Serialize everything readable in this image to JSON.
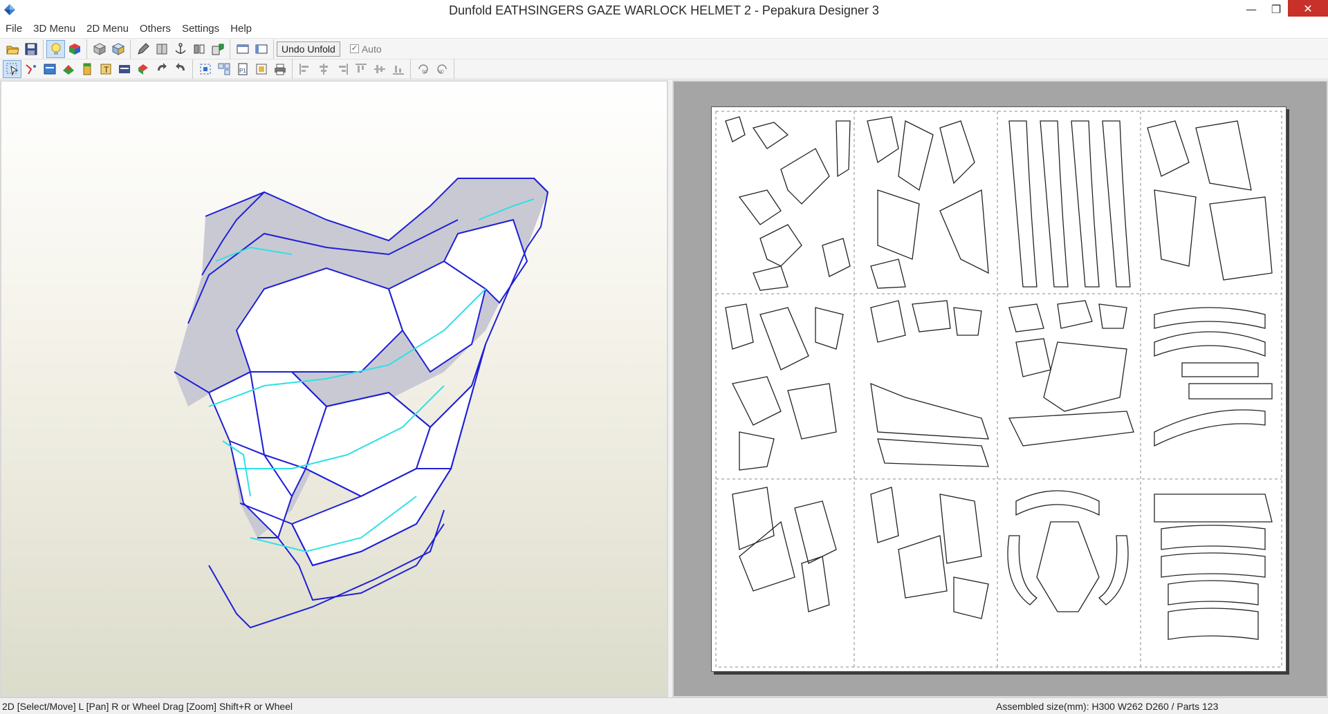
{
  "window": {
    "title": "Dunfold EATHSINGERS GAZE WARLOCK HELMET 2 - Pepakura Designer 3",
    "minimize": "—",
    "maximize": "❐",
    "close": "✕"
  },
  "menu": [
    "File",
    "3D Menu",
    "2D Menu",
    "Others",
    "Settings",
    "Help"
  ],
  "toolbar1": {
    "icons": [
      "open-icon",
      "save-icon",
      "light-icon",
      "color-cube-icon",
      "box-icon",
      "box-open-icon",
      "pencil-icon",
      "book-icon",
      "anchor-icon",
      "flip-icon",
      "fold-icon",
      "window-left-icon",
      "window-right-icon"
    ],
    "undo_unfold": "Undo Unfold",
    "auto_label": "Auto",
    "auto_checked": "✓"
  },
  "toolbar2": {
    "icons": [
      "select-icon",
      "join-icon",
      "layout-icon",
      "texture-icon",
      "flap-icon",
      "edge-icon",
      "image-icon",
      "move-part-icon",
      "rotate-icon",
      "rotate-back-icon",
      "fit-icon",
      "arrange-icon",
      "page-icon",
      "print-preview-icon",
      "print-icon",
      "align-left-icon",
      "align-center-icon",
      "align-right-icon",
      "align-top-icon",
      "align-middle-icon",
      "align-bottom-icon",
      "rotate-90-left-icon",
      "rotate-90-right-icon"
    ]
  },
  "status": {
    "left": "2D [Select/Move] L [Pan] R or Wheel Drag [Zoom] Shift+R or Wheel",
    "right": "Assembled size(mm): H300 W262 D260 / Parts 123"
  },
  "colors": {
    "wire": "#1f1fd6",
    "cut": "#2ee0e6",
    "face_light": "#ffffff",
    "face_shade": "#c8c8d2"
  }
}
